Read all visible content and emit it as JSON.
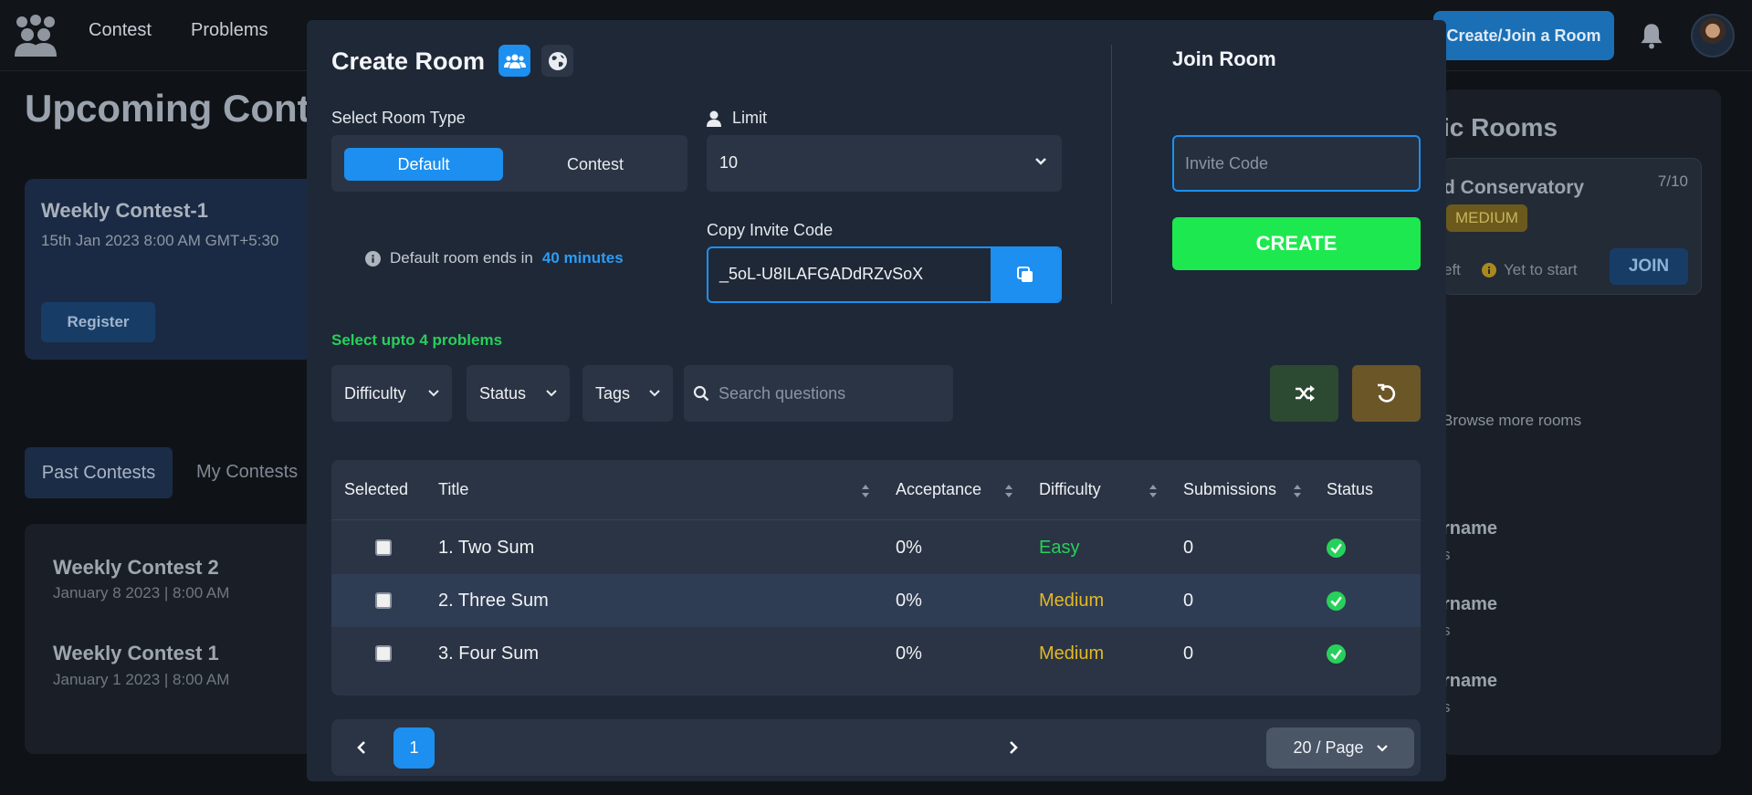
{
  "nav": {
    "links": [
      "Contest",
      "Problems"
    ],
    "create_join_label": "Create/Join a Room"
  },
  "background": {
    "upcoming_title": "Upcoming Cont",
    "contest_card": {
      "title": "Weekly Contest-1",
      "date": "15th Jan 2023 8:00 AM GMT+5:30",
      "register_label": "Register"
    },
    "tabs": {
      "past": "Past Contests",
      "mine": "My Contests"
    },
    "past_contests": [
      {
        "title": "Weekly Contest 2",
        "date": "January 8 2023 | 8:00 AM"
      },
      {
        "title": "Weekly Contest 1",
        "date": "January 1 2023 | 8:00 AM"
      }
    ],
    "public_rooms": {
      "title": "ic Rooms",
      "room": {
        "name": "d Conservatory",
        "count": "7/10",
        "difficulty": "MEDIUM",
        "left": "eft",
        "status": "Yet to start",
        "join_label": "JOIN"
      },
      "browse_label": "Browse more rooms",
      "users": [
        {
          "name": "rname",
          "sub": "s"
        },
        {
          "name": "rname",
          "sub": "s"
        },
        {
          "name": "rname",
          "sub": "s"
        }
      ]
    }
  },
  "modal": {
    "title": "Create Room",
    "room_type_label": "Select Room Type",
    "room_types": {
      "default": "Default",
      "contest": "Contest"
    },
    "limit_label": "Limit",
    "limit_value": "10",
    "info_prefix": "Default room ends in",
    "info_highlight": "40 minutes",
    "invite_label": "Copy Invite Code",
    "invite_code": "_5oL-U8ILAFGADdRZvSoX",
    "join": {
      "title": "Join Room",
      "placeholder": "Invite Code",
      "create_label": "CREATE"
    },
    "select_hint": "Select upto 4 problems",
    "filters": {
      "difficulty": "Difficulty",
      "status": "Status",
      "tags": "Tags",
      "search_placeholder": "Search questions"
    },
    "table": {
      "headers": {
        "selected": "Selected",
        "title": "Title",
        "acceptance": "Acceptance",
        "difficulty": "Difficulty",
        "submissions": "Submissions",
        "status": "Status"
      },
      "rows": [
        {
          "title": "1. Two Sum",
          "acceptance": "0%",
          "difficulty": "Easy",
          "submissions": "0"
        },
        {
          "title": "2. Three Sum",
          "acceptance": "0%",
          "difficulty": "Medium",
          "submissions": "0"
        },
        {
          "title": "3. Four Sum",
          "acceptance": "0%",
          "difficulty": "Medium",
          "submissions": "0"
        }
      ]
    },
    "pager": {
      "current_page": "1",
      "page_size": "20 / Page"
    }
  },
  "colors": {
    "accent": "#1c8ff0",
    "create": "#1ee84f",
    "easy": "#27d05a",
    "medium": "#e3b826"
  }
}
